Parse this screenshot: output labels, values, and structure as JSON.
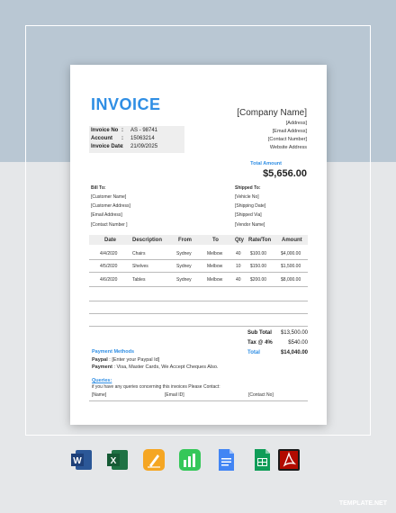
{
  "invoice": {
    "title": "INVOICE",
    "meta": [
      {
        "key": "Invoice No",
        "value": "AS - 98741"
      },
      {
        "key": "Account",
        "value": "15063214"
      },
      {
        "key": "Invoice Date",
        "value": "21/09/2025"
      }
    ],
    "company": "[Company Name]",
    "address_lines": [
      "[Address]",
      "[Email Address]",
      "[Contact Number]",
      "Website Address"
    ],
    "total_amount_label": "Total Amount",
    "total_amount": "$5,656.00",
    "bill_to": {
      "label": "Bill To:",
      "lines": [
        "[Customer Name]",
        "[Customer Address]",
        "[Email Address]",
        "[Contact Number ]"
      ]
    },
    "shipped_to": {
      "label": "Shipped To:",
      "lines": [
        "[Vehicle No]",
        "[Shipping Date]",
        "[Shipped Via]",
        "[Vendor Name]"
      ]
    },
    "table": {
      "headers": [
        "Date",
        "Description",
        "From",
        "To",
        "Qty",
        "Rate/Ton",
        "Amount"
      ],
      "rows": [
        [
          "4/4/2020",
          "Chairs",
          "Sydney",
          "Melbow",
          "40",
          "$100.00",
          "$4,000.00"
        ],
        [
          "4/5/2020",
          "Shelves",
          "Sydney",
          "Melbow",
          "10",
          "$150.00",
          "$1,500.00"
        ],
        [
          "4/6/2020",
          "Tables",
          "Sydney",
          "Melbow",
          "40",
          "$200.00",
          "$8,000.00"
        ]
      ]
    },
    "summary": {
      "subtotal_label": "Sub Total",
      "subtotal": "$13,500.00",
      "tax_label": "Tax @ 4%",
      "tax": "$540.00",
      "total_label": "Total",
      "total": "$14,040.00"
    },
    "payment": {
      "heading": "Payment Methods",
      "paypal_label": "Paypal",
      "paypal_value": ": [Enter your Paypal Id]",
      "payment_label": "Payment",
      "payment_value": ": Visa, Master Cards, We Accept Cheques Also."
    },
    "queries": {
      "heading": "Queries:",
      "text": "if you have any queries concerning this invoices Please Contact:",
      "name": "[Name]",
      "email": "[Email ID]",
      "contact": "[Contact No]"
    }
  },
  "apps": [
    {
      "name": "word-icon",
      "letter": "W",
      "color": "#2b5797"
    },
    {
      "name": "excel-icon",
      "letter": "X",
      "color": "#1f7244"
    },
    {
      "name": "pages-icon",
      "letter": "✎",
      "color": "#f39c12"
    },
    {
      "name": "numbers-icon",
      "letter": "▮",
      "color": "#2ecc40"
    },
    {
      "name": "google-docs-icon",
      "letter": "≡",
      "color": "#4285f4"
    },
    {
      "name": "google-sheets-icon",
      "letter": "▦",
      "color": "#0f9d58"
    },
    {
      "name": "pdf-icon",
      "letter": "A",
      "color": "#b30b00"
    }
  ],
  "footer": "TEMPLATE.NET"
}
